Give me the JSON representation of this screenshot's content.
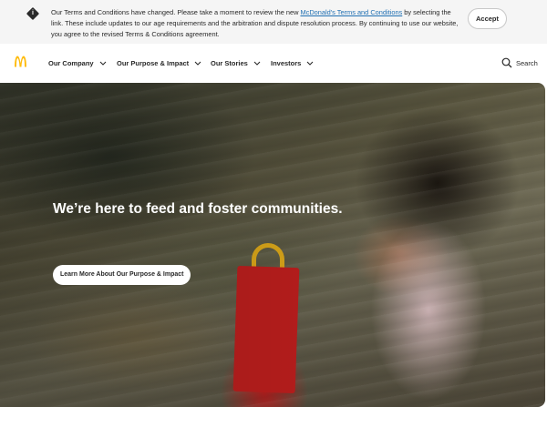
{
  "terms": {
    "text_before_link": "Our Terms and Conditions have changed. Please take a moment to review the new ",
    "link_text": "McDonald's Terms and Conditions",
    "text_after_link": " by selecting the link. These include updates to our age requirements and the arbitration and dispute resolution process. By continuing to use our website, you agree to the revised Terms & Conditions agreement.",
    "accept_label": "Accept",
    "icon": "info-diamond-icon"
  },
  "nav": {
    "logo": "golden-arches-logo",
    "items": [
      {
        "label": "Our Company"
      },
      {
        "label": "Our Purpose & Impact"
      },
      {
        "label": "Our Stories"
      },
      {
        "label": "Investors"
      }
    ],
    "search_label": "Search"
  },
  "hero": {
    "title": "We’re here to feed and foster communities.",
    "cta_label": "Learn More About Our Purpose & Impact"
  },
  "colors": {
    "brand_yellow": "#ffbc0d",
    "link_blue": "#1f6fb2",
    "text_dark": "#292929"
  }
}
